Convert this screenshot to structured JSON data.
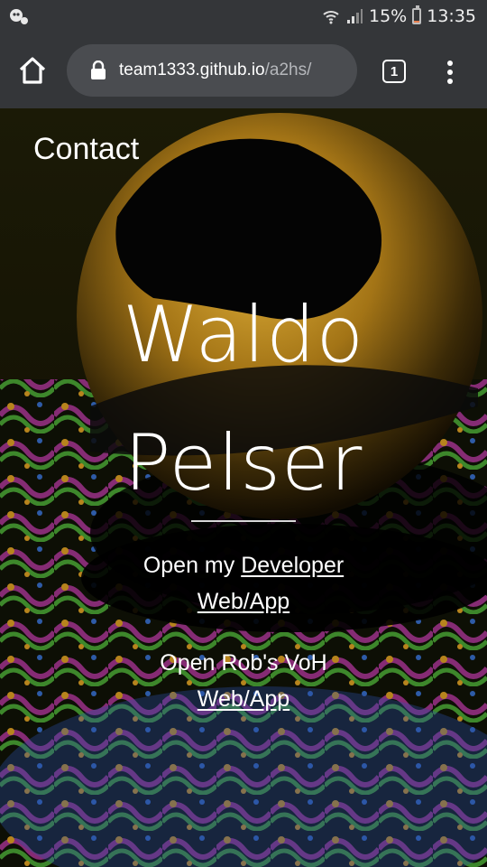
{
  "status_bar": {
    "battery_percent": "15%",
    "time": "13:35",
    "battery_level": 0.15,
    "battery_color": "#e67e50"
  },
  "browser": {
    "url_host": "team1333.github.io",
    "url_path": "/a2hs/",
    "tab_count": "1",
    "toolbar_color": "#343639",
    "icons": [
      "home-icon",
      "lock-icon",
      "tabs-icon",
      "overflow-menu-icon"
    ]
  },
  "page": {
    "nav_link": "Contact",
    "title_line1": "Waldo",
    "title_line2": "Pelser",
    "link1_prefix": "Open my",
    "link1_text_a": "Developer",
    "link1_text_b": "Web/App",
    "link2_prefix": "Open Rob's VoH",
    "link2_text": "Web/App"
  }
}
